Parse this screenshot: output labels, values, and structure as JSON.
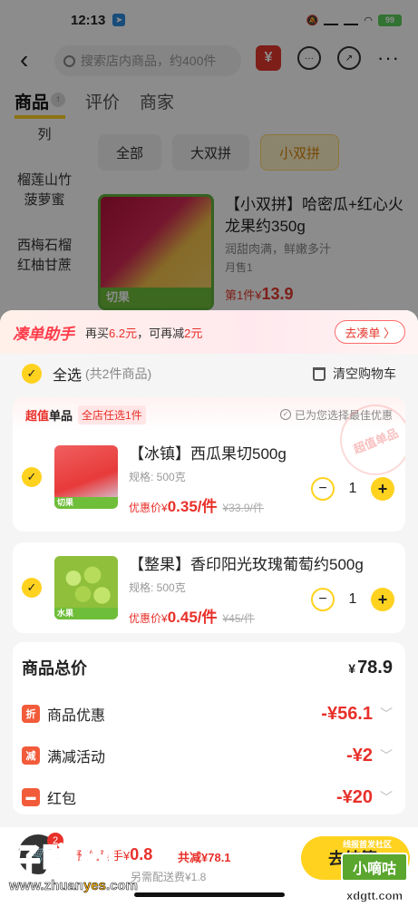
{
  "status": {
    "time": "12:13",
    "battery": "99"
  },
  "topbar": {
    "search_placeholder": "搜索店内商品，约400件",
    "yen_icon": "¥"
  },
  "main_tabs": [
    {
      "label": "商品",
      "badge": "↑"
    },
    {
      "label": "评价"
    },
    {
      "label": "商家"
    }
  ],
  "categories": [
    "列",
    "榴莲山竹菠萝蜜",
    "西梅石榴红柚甘蔗"
  ],
  "filters": [
    "全部",
    "大双拼",
    "小双拼"
  ],
  "product": {
    "title": "【小双拼】哈密瓜+红心火龙果约350g",
    "desc": "润甜肉满，鲜嫩多汁",
    "sales": "月售1",
    "price_prefix": "第1件¥",
    "price": "13.9",
    "img_tag": "切果"
  },
  "assist": {
    "logo": "凑单助手",
    "text_pre": "再买",
    "amount": "6.2元",
    "text_mid": "，可再减",
    "reduce": "2元",
    "button": "去凑单 〉"
  },
  "select_all": {
    "label": "全选",
    "count": "(共2件商品)",
    "clear": "清空购物车"
  },
  "promo": {
    "tag_red": "超值",
    "tag_black": "单品",
    "scope": "全店任选1件",
    "best": "已为您选择最佳优惠",
    "stamp": "超值单品"
  },
  "items": [
    {
      "title": "【冰镇】西瓜果切500g",
      "spec": "规格: 500克",
      "price_label": "优惠价¥",
      "price": "0.35/件",
      "orig": "¥33.9/件",
      "qty": "1",
      "thumb_tag": "切果"
    },
    {
      "title": "【整果】香印阳光玫瑰葡萄约500g",
      "spec": "规格: 500克",
      "price_label": "优惠价¥",
      "price": "0.45/件",
      "orig": "¥45/件",
      "qty": "1",
      "thumb_tag": "水果"
    }
  ],
  "summary": {
    "total_label": "商品总价",
    "total_cur": "¥",
    "total": "78.9",
    "rows": [
      {
        "icon": "折",
        "label": "商品优惠",
        "amount": "-¥56.1"
      },
      {
        "icon": "减",
        "label": "满减活动",
        "amount": "-¥2"
      },
      {
        "icon": "▬",
        "label": "红包",
        "amount": "-¥20"
      }
    ]
  },
  "bottom": {
    "cart_count": "2",
    "price_prefix": "预估到手¥",
    "price": "0.8",
    "saved": "共减¥78.1",
    "fee": "另需配送费¥1.8",
    "checkout": "去结算"
  },
  "watermark": {
    "big": "好赚网",
    "url_pre": "www.zhuan",
    "url_mid": "yes",
    "url_post": ".com",
    "right_top": "线报首发社区",
    "right_box": "小嘀咕",
    "right_url": "xdgtt.com"
  }
}
